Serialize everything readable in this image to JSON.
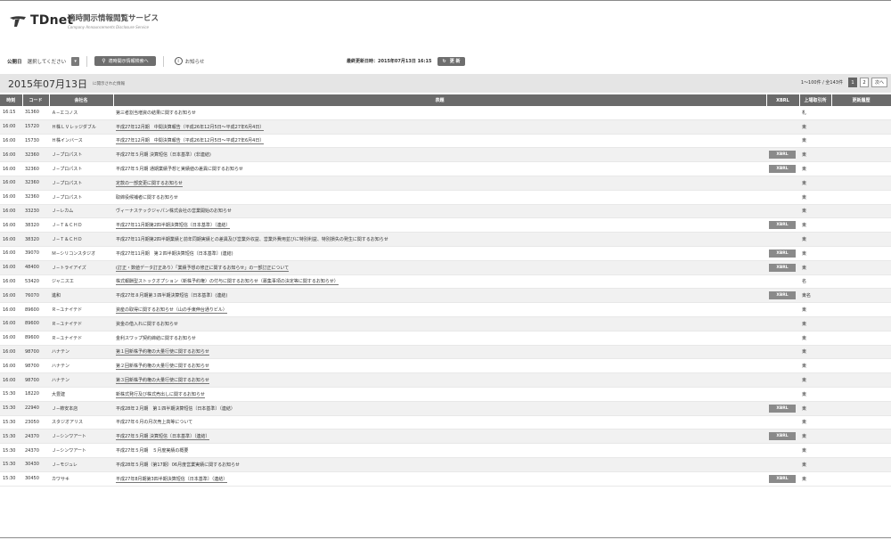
{
  "brand": {
    "logo_text": "TDnet",
    "service_title": "適時開示情報閲覧サービス",
    "service_sub": "Company Announcements Disclosure Service"
  },
  "toolbar": {
    "date_label": "公開日",
    "date_select": "選択してください",
    "search_button": "適時開示情報検索へ",
    "notice_link": "お知らせ",
    "updated_text": "最終更新日時：2015年07月13日 16:15",
    "refresh_button": "更 新"
  },
  "section": {
    "date_title": "2015年07月13日",
    "date_note": "に開示された情報",
    "pager_range": "1〜100件 / 全143件",
    "page_current": "1",
    "page_2": "2",
    "page_next": "次へ"
  },
  "table": {
    "headers": {
      "time": "時刻",
      "code": "コード",
      "company": "会社名",
      "title": "表題",
      "xbrl": "XBRL",
      "exchange": "上場取引所",
      "history": "更新履歴"
    },
    "rows": [
      {
        "time": "16:15",
        "code": "31360",
        "company": "Ａ−エコノス",
        "title": "第三者割当増資の結果に関するお知らせ",
        "link": false,
        "xbrl": "",
        "exchange": "札"
      },
      {
        "time": "16:00",
        "code": "15720",
        "company": "Ｈ株ＬＶレッジダブル",
        "title": "平成27年12月期　中間決算報告（平成26年12月5日〜平成27年6月4日）",
        "link": true,
        "xbrl": "",
        "exchange": "東"
      },
      {
        "time": "16:00",
        "code": "15730",
        "company": "Ｈ株インバース",
        "title": "平成27年12月期　中間決算報告（平成26年12月5日〜平成27年6月4日）",
        "link": true,
        "xbrl": "",
        "exchange": "東"
      },
      {
        "time": "16:00",
        "code": "32360",
        "company": "Ｊ−プロパスト",
        "title": "平成27年５月期 決算短信〔日本基準〕(非連結)",
        "link": false,
        "xbrl": "XBRL",
        "exchange": "東"
      },
      {
        "time": "16:00",
        "code": "32360",
        "company": "Ｊ−プロパスト",
        "title": "平成27年５月期 通期業績予想と実績値の差異に関するお知らせ",
        "link": false,
        "xbrl": "XBRL",
        "exchange": "東"
      },
      {
        "time": "16:00",
        "code": "32360",
        "company": "Ｊ−プロパスト",
        "title": "定款の一部変更に関するお知らせ",
        "link": true,
        "xbrl": "",
        "exchange": "東"
      },
      {
        "time": "16:00",
        "code": "32360",
        "company": "Ｊ−プロパスト",
        "title": "取締役候補者に関するお知らせ",
        "link": false,
        "xbrl": "",
        "exchange": "東"
      },
      {
        "time": "16:00",
        "code": "33230",
        "company": "Ｊ−レカム",
        "title": "ヴィーナステックジャパン株式会社の営業開始のお知らせ",
        "link": false,
        "xbrl": "",
        "exchange": "東"
      },
      {
        "time": "16:00",
        "code": "38320",
        "company": "Ｊ−Ｔ＆ＣＨＤ",
        "title": "平成27年11月期第2四半期決算短信〔日本基準〕（連結）",
        "link": true,
        "xbrl": "XBRL",
        "exchange": "東"
      },
      {
        "time": "16:00",
        "code": "38320",
        "company": "Ｊ−Ｔ＆ＣＨＤ",
        "title": "平成27年11月期第2四半期業績と前年同期実績との差異及び営業外収益、営業外費用並びに特別利益、特別損失の発生に関するお知らせ",
        "link": false,
        "xbrl": "",
        "exchange": "東"
      },
      {
        "time": "16:00",
        "code": "39070",
        "company": "Ｍ−シリコンスタジオ",
        "title": "平成27年11月期　第２四半期決算短信〔日本基準〕(連結)",
        "link": false,
        "xbrl": "XBRL",
        "exchange": "東"
      },
      {
        "time": "16:00",
        "code": "48400",
        "company": "Ｊ−トライアイズ",
        "title": "(訂正・数値データ訂正あり）「業績予想の修正に関するお知らせ」の一部訂正について",
        "link": true,
        "xbrl": "XBRL",
        "exchange": "東"
      },
      {
        "time": "16:00",
        "code": "53420",
        "company": "ジャニス工",
        "title": "株式報酬型ストックオプション（新株予約権）の付与に関するお知らせ（募集事項の決定等に関するお知らせ）",
        "link": true,
        "xbrl": "",
        "exchange": "名"
      },
      {
        "time": "16:00",
        "code": "76070",
        "company": "進和",
        "title": "平成27年８月期第３四半期決算短信〔日本基準〕(連結)",
        "link": false,
        "xbrl": "XBRL",
        "exchange": "東名"
      },
      {
        "time": "16:00",
        "code": "89600",
        "company": "Ｒ−ユナイテド",
        "title": "資産の取得に関するお知らせ（山の手東伸台通りビル）",
        "link": true,
        "xbrl": "",
        "exchange": "東"
      },
      {
        "time": "16:00",
        "code": "89600",
        "company": "Ｒ−ユナイテド",
        "title": "資金の借入れに関するお知らせ",
        "link": false,
        "xbrl": "",
        "exchange": "東"
      },
      {
        "time": "16:00",
        "code": "89600",
        "company": "Ｒ−ユナイテド",
        "title": "金利スワップ契約締結に関するお知らせ",
        "link": false,
        "xbrl": "",
        "exchange": "東"
      },
      {
        "time": "16:00",
        "code": "98700",
        "company": "ハナテン",
        "title": "第１回新株予約権の大量行使に関するお知らせ",
        "link": true,
        "xbrl": "",
        "exchange": "東"
      },
      {
        "time": "16:00",
        "code": "98700",
        "company": "ハナテン",
        "title": "第２回新株予約権の大量行使に関するお知らせ",
        "link": true,
        "xbrl": "",
        "exchange": "東"
      },
      {
        "time": "16:00",
        "code": "98700",
        "company": "ハナテン",
        "title": "第３回新株予約権の大量行使に関するお知らせ",
        "link": true,
        "xbrl": "",
        "exchange": "東"
      },
      {
        "time": "15:30",
        "code": "18220",
        "company": "大豊建",
        "title": "新株式発行及び株式売出しに関するお知らせ",
        "link": true,
        "xbrl": "",
        "exchange": "東"
      },
      {
        "time": "15:30",
        "code": "22940",
        "company": "Ｊ−柿安本店",
        "title": "平成28年２月期　第１四半期決算短信〔日本基準〕（連結）",
        "link": false,
        "xbrl": "XBRL",
        "exchange": "東"
      },
      {
        "time": "15:30",
        "code": "23050",
        "company": "スタジオアリス",
        "title": "平成27年６月の月次売上高等について",
        "link": false,
        "xbrl": "",
        "exchange": "東"
      },
      {
        "time": "15:30",
        "code": "24370",
        "company": "Ｊ−シンワアート",
        "title": "平成27年５月期 決算短信〔日本基準〕（連結）",
        "link": true,
        "xbrl": "XBRL",
        "exchange": "東"
      },
      {
        "time": "15:30",
        "code": "24370",
        "company": "Ｊ−シンワアート",
        "title": "平成27年５月期　５月度実績の概要",
        "link": false,
        "xbrl": "",
        "exchange": "東"
      },
      {
        "time": "15:30",
        "code": "30430",
        "company": "Ｊ−モジュレ",
        "title": "平成28年５月期（第17期）06月度営業実績に関するお知らせ",
        "link": false,
        "xbrl": "",
        "exchange": "東"
      },
      {
        "time": "15:30",
        "code": "30450",
        "company": "カワサキ",
        "title": "平成27年8月期第3四半期決算短信〔日本基準〕（連結）",
        "link": true,
        "xbrl": "XBRL",
        "exchange": "東"
      }
    ]
  }
}
